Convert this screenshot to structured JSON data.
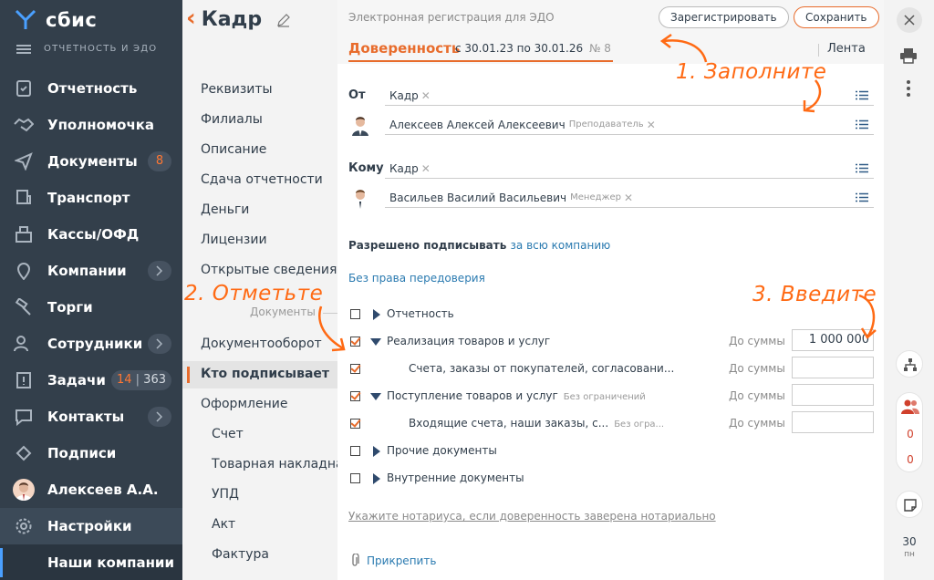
{
  "nav": {
    "logo": "сбис",
    "subtitle": "ОТЧЕТНОСТЬ И ЭДО",
    "items": [
      {
        "label": "Отчетность",
        "icon": "report-icon"
      },
      {
        "label": "Уполномочка",
        "icon": "handshake-icon"
      },
      {
        "label": "Документы",
        "icon": "send-icon",
        "count": "8"
      },
      {
        "label": "Транспорт",
        "icon": "truck-icon"
      },
      {
        "label": "Кассы/ОФД",
        "icon": "cashbox-icon"
      },
      {
        "label": "Компании",
        "icon": "location-icon"
      },
      {
        "label": "Торги",
        "icon": "gavel-icon"
      },
      {
        "label": "Сотрудники",
        "icon": "people-icon"
      },
      {
        "label": "Задачи",
        "icon": "tasks-icon",
        "count_a": "14",
        "count_b": "363"
      },
      {
        "label": "Контакты",
        "icon": "chat-icon"
      },
      {
        "label": "Подписи",
        "icon": "signature-icon"
      },
      {
        "label": "Алексеев А.А.",
        "icon": "avatar"
      },
      {
        "label": "Настройки",
        "icon": "gear-icon"
      },
      {
        "label": "Наши компании",
        "icon": ""
      }
    ]
  },
  "mid": {
    "title": "Кадр",
    "links": [
      "Реквизиты",
      "Филиалы",
      "Описание",
      "Сдача отчетности",
      "Деньги",
      "Лицензии",
      "Открытые сведения"
    ],
    "group": "Документы",
    "doc_links": [
      "Документооборот",
      "Кто подписывает",
      "Оформление"
    ],
    "sub_links": [
      "Счет",
      "Товарная накладная",
      "УПД",
      "Акт",
      "Фактура"
    ]
  },
  "main": {
    "reg_title": "Электронная регистрация для ЭДО",
    "register_btn": "Зарегистрировать",
    "save_btn": "Сохранить",
    "doc_title": "Доверенность",
    "doc_dates": "с 30.01.23 по 30.01.26",
    "doc_num": "№ 8",
    "lenta": "Лента",
    "from_label": "От",
    "from_org": "Кадр",
    "from_person": "Алексеев Алексей Алексеевич",
    "from_role": "Преподаватель",
    "to_label": "Кому",
    "to_org": "Кадр",
    "to_person": "Васильев Василий Васильевич",
    "to_role": "Менеджер",
    "allowed_sign": "Разрешено подписывать",
    "allowed_scope": "за всю компанию",
    "no_redelegation": "Без права передоверия",
    "amount_label": "До суммы",
    "rows": [
      {
        "label": "Отчетность",
        "checked": false,
        "arrow": "right"
      },
      {
        "label": "Реализация товаров и услуг",
        "checked": true,
        "arrow": "down",
        "amount": "1 000 000"
      },
      {
        "label": "Счета, заказы от покупателей, согласовани...",
        "checked": true
      },
      {
        "label": "Поступление товаров и услуг",
        "checked": true,
        "arrow": "down",
        "note": "Без ограничений"
      },
      {
        "label": "Входящие счета, наши заказы, с...",
        "checked": true,
        "note": "Без огра..."
      },
      {
        "label": "Прочие документы",
        "checked": false,
        "arrow": "right"
      },
      {
        "label": "Внутренние документы",
        "checked": false,
        "arrow": "right"
      }
    ],
    "notary": "Укажите нотариуса, если доверенность заверена нотариально",
    "attach": "Прикрепить"
  },
  "annotations": {
    "step1": "1. Заполните",
    "step2": "2. Отметьте",
    "step3": "3. Введите"
  },
  "rbar": {
    "count1": "0",
    "count2": "0",
    "date_num": "30",
    "date_day": "пн"
  },
  "colors": {
    "nav_bg": "#333f4b",
    "accent": "#e86c2c",
    "annotation": "#ff6a14",
    "link": "#2a7ab0"
  }
}
